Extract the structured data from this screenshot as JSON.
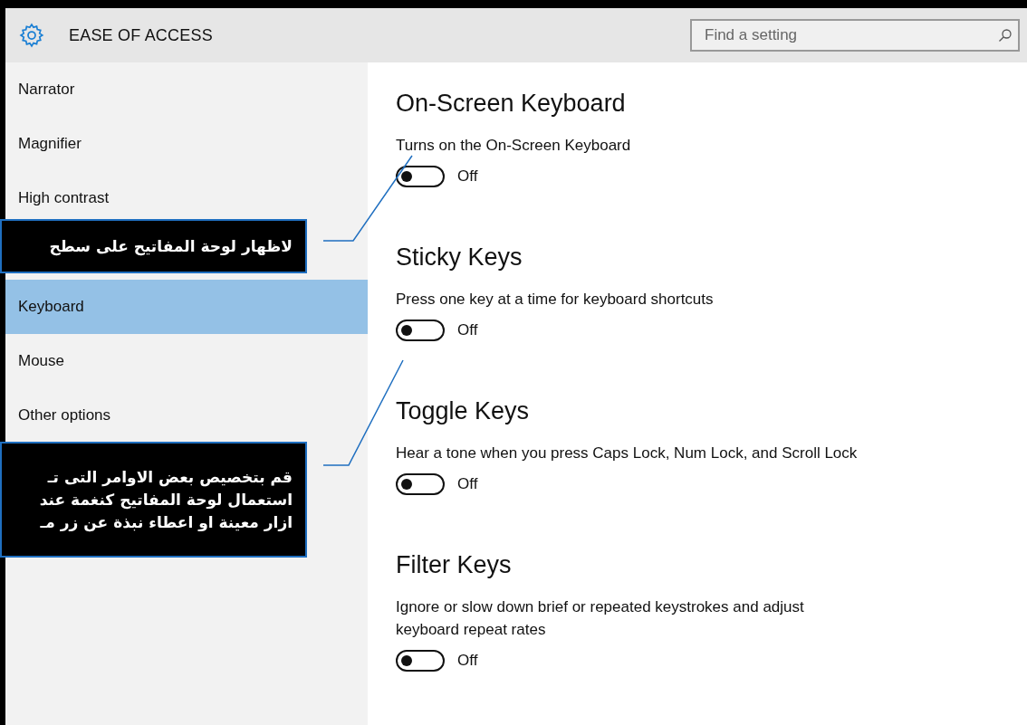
{
  "header": {
    "title": "EASE OF ACCESS",
    "search": {
      "placeholder": "Find a setting"
    }
  },
  "sidebar": {
    "items": [
      {
        "kind": "item",
        "label": "Narrator",
        "selected": false
      },
      {
        "kind": "item",
        "label": "Magnifier",
        "selected": false
      },
      {
        "kind": "item",
        "label": "High contrast",
        "selected": false
      },
      {
        "kind": "callout",
        "lines": [
          "لاظهار لوحة المفاتيح على سطح"
        ]
      },
      {
        "kind": "item",
        "label": "Keyboard",
        "selected": true
      },
      {
        "kind": "item",
        "label": "Mouse",
        "selected": false
      },
      {
        "kind": "item",
        "label": "Other options",
        "selected": false
      },
      {
        "kind": "callout",
        "lines": [
          "قم بتخصيص بعض الاوامر التى تـ",
          "استعمال لوحة المفاتيح كنغمة عند",
          "ازار معينة او اعطاء نبذة عن زر مـ"
        ]
      }
    ]
  },
  "sections": [
    {
      "title": "On-Screen Keyboard",
      "description": "Turns on the On-Screen Keyboard",
      "toggle": {
        "on": false,
        "label": "Off"
      }
    },
    {
      "title": "Sticky Keys",
      "description": "Press one key at a time for keyboard shortcuts",
      "toggle": {
        "on": false,
        "label": "Off"
      }
    },
    {
      "title": "Toggle Keys",
      "description": "Hear a tone when you press Caps Lock, Num Lock, and Scroll Lock",
      "toggle": {
        "on": false,
        "label": "Off"
      }
    },
    {
      "title": "Filter Keys",
      "description": "Ignore or slow down brief or repeated keystrokes and adjust keyboard repeat rates",
      "toggle": {
        "on": false,
        "label": "Off"
      }
    }
  ]
}
